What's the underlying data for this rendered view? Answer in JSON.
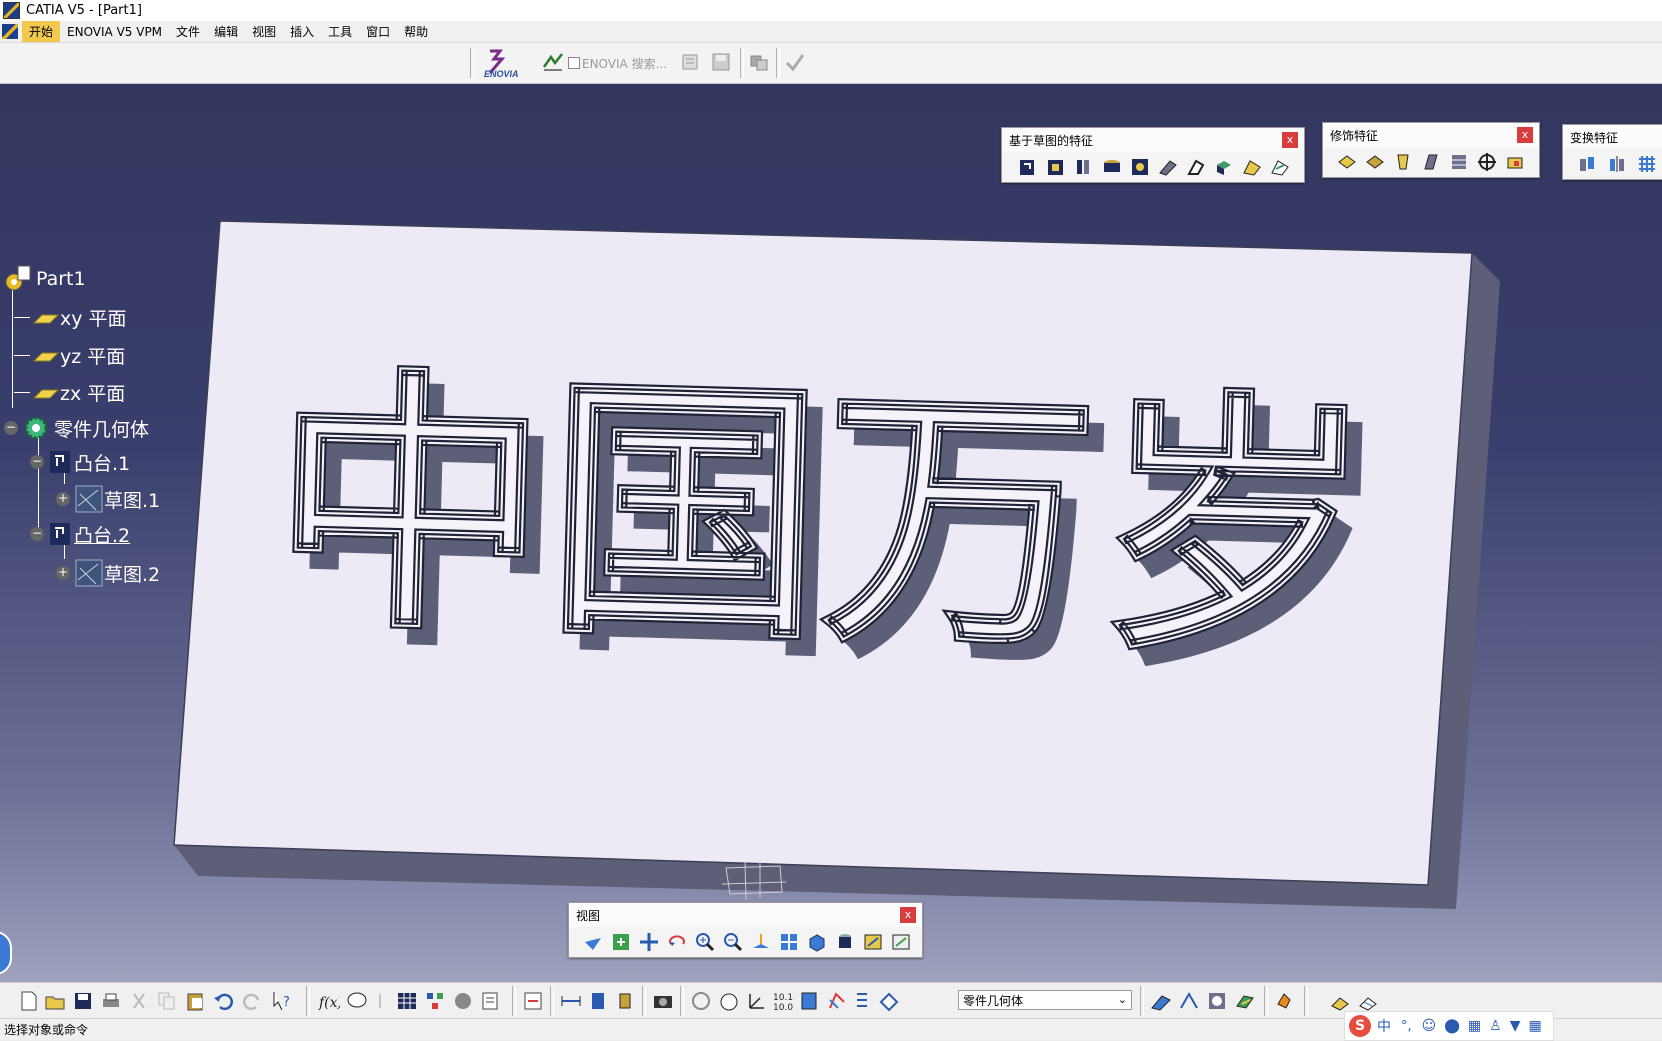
{
  "window": {
    "title": "CATIA V5 - [Part1]"
  },
  "menu": [
    "开始",
    "ENOVIA V5 VPM",
    "文件",
    "编辑",
    "视图",
    "插入",
    "工具",
    "窗口",
    "帮助"
  ],
  "top_toolbar": {
    "enovia_logo": "ENOVIA",
    "enovia_search": "ENOVIA 搜索..."
  },
  "tree": {
    "root": "Part1",
    "items": [
      {
        "label": "xy 平面",
        "icon": "plane-icon"
      },
      {
        "label": "yz 平面",
        "icon": "plane-icon"
      },
      {
        "label": "zx 平面",
        "icon": "plane-icon"
      },
      {
        "label": "零件几何体",
        "icon": "body-gear-icon"
      },
      {
        "label": "凸台.1",
        "icon": "pad-icon"
      },
      {
        "label": "草图.1",
        "icon": "sketch-icon"
      },
      {
        "label": "凸台.2",
        "icon": "pad-icon"
      },
      {
        "label": "草图.2",
        "icon": "sketch-icon"
      }
    ]
  },
  "model": {
    "text": "中国万岁",
    "face_color": "#eceaf5",
    "side_color": "#5d5f78"
  },
  "palettes": {
    "sketch_features": {
      "title": "基于草图的特征",
      "close": "x"
    },
    "dress_up_features": {
      "title": "修饰特征",
      "close": "x"
    },
    "transform_features": {
      "title": "变换特征"
    },
    "view": {
      "title": "视图",
      "close": "x"
    }
  },
  "bottom_toolbar": {
    "current_body": "零件几何体"
  },
  "status": {
    "prompt": "选择对象或命令"
  },
  "ime": {
    "lang": "中"
  }
}
